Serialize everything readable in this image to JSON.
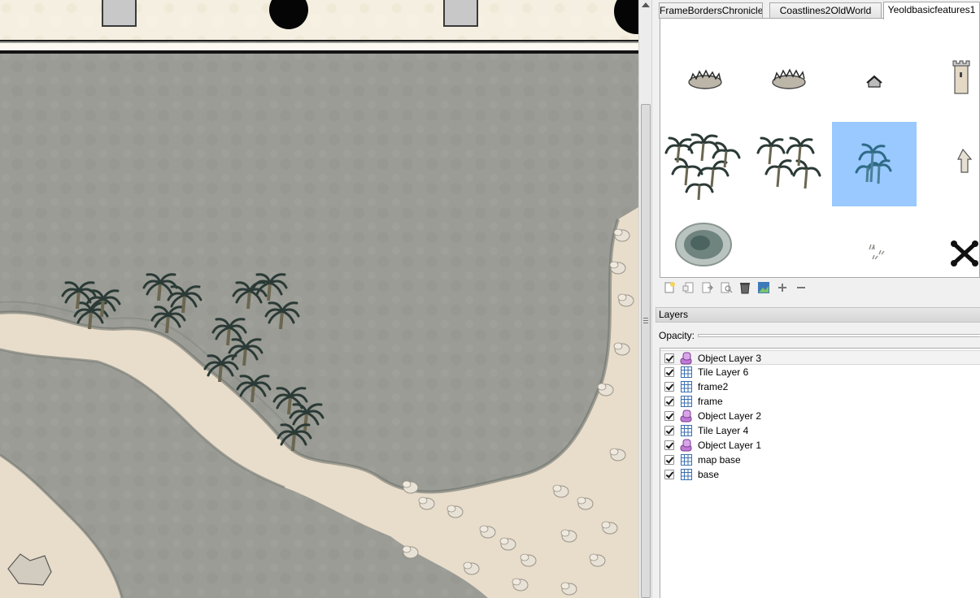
{
  "tileset_tabs": [
    "FrameBordersChronicle",
    "Coastlines2OldWorld",
    "Yeoldbasicfeatures1"
  ],
  "active_tab_index": 2,
  "tiles": [
    {
      "icon": "ruined-fort-icon"
    },
    {
      "icon": "ruined-fort-icon"
    },
    {
      "icon": "small-house-icon"
    },
    {
      "icon": "tower-icon"
    },
    {
      "icon": "dense-palm-grove-icon"
    },
    {
      "icon": "palm-trees-icon"
    },
    {
      "icon": "palm-tree-icon",
      "selected": true
    },
    {
      "icon": "spire-icon"
    },
    {
      "icon": "pond-icon"
    },
    {
      "icon": "empty"
    },
    {
      "icon": "grass-tufts-icon"
    },
    {
      "icon": "crossed-bones-icon"
    }
  ],
  "tileset_toolbar": [
    "new-tileset-icon",
    "import-tileset-icon",
    "export-tileset-icon",
    "tileset-properties-icon",
    "delete-tileset-icon",
    "edit-terrain-icon",
    "zoom-in-icon",
    "zoom-out-icon"
  ],
  "layers_dock": {
    "title": "Layers",
    "opacity_label": "Opacity:",
    "opacity_value": 1.0,
    "layers": [
      {
        "name": "Object Layer 3",
        "type": "object",
        "visible": true,
        "current": true
      },
      {
        "name": "Tile Layer 6",
        "type": "tile",
        "visible": true
      },
      {
        "name": "frame2",
        "type": "tile",
        "visible": true
      },
      {
        "name": "frame",
        "type": "tile",
        "visible": true
      },
      {
        "name": "Object Layer 2",
        "type": "object",
        "visible": true
      },
      {
        "name": "Tile Layer 4",
        "type": "tile",
        "visible": true
      },
      {
        "name": "Object Layer 1",
        "type": "object",
        "visible": true
      },
      {
        "name": "map base",
        "type": "tile",
        "visible": true
      },
      {
        "name": "base",
        "type": "tile",
        "visible": true
      }
    ]
  },
  "colors": {
    "sea": "#9a9c95",
    "sand": "#e8dccb",
    "selection": "#99c9ff",
    "palm": "#2b3a36",
    "object_layer_icon": "#c07ad6",
    "tile_layer_icon": "#3a6fb0"
  }
}
